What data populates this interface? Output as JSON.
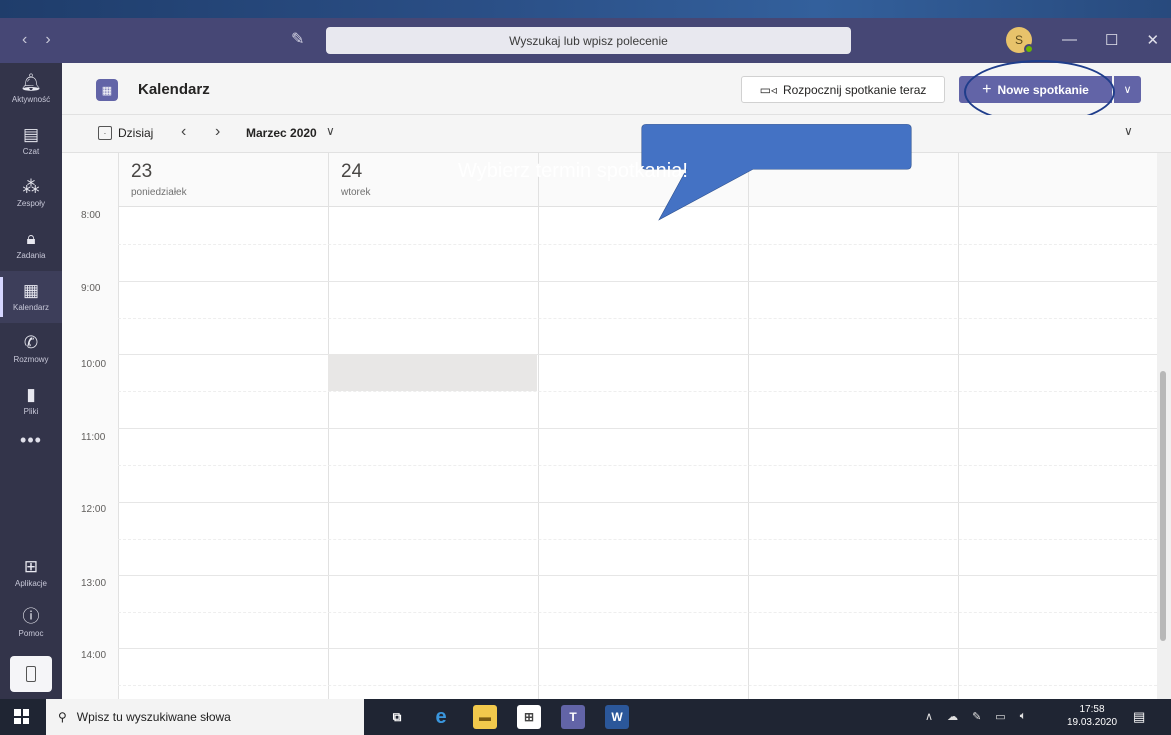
{
  "titlebar": {
    "back": "‹",
    "forward": "›",
    "search_placeholder": "Wyszukaj lub wpisz polecenie",
    "avatar_initial": "S",
    "minimize": "—",
    "maximize": "☐",
    "close": "✕"
  },
  "rail": {
    "items": [
      {
        "label": "Aktywność",
        "icon": "bell-icon"
      },
      {
        "label": "Czat",
        "icon": "chat-icon"
      },
      {
        "label": "Zespoły",
        "icon": "teams-icon"
      },
      {
        "label": "Zadania",
        "icon": "tasks-icon"
      },
      {
        "label": "Kalendarz",
        "icon": "calendar-icon"
      },
      {
        "label": "Rozmowy",
        "icon": "phone-icon"
      },
      {
        "label": "Pliki",
        "icon": "file-icon"
      },
      {
        "label": "Aplikacje",
        "icon": "apps-icon"
      },
      {
        "label": "Pomoc",
        "icon": "help-icon"
      }
    ],
    "more": "•••",
    "active": "Kalendarz"
  },
  "header": {
    "title": "Kalendarz",
    "meet_now": "Rozpocznij spotkanie teraz",
    "new_meeting": "Nowe spotkanie"
  },
  "toolbar": {
    "today": "Dzisiaj",
    "month": "Marzec 2020"
  },
  "calendar": {
    "days": [
      {
        "num": "23",
        "name": "poniedziałek"
      },
      {
        "num": "24",
        "name": "wtorek"
      }
    ],
    "times": [
      "8:00",
      "9:00",
      "10:00",
      "11:00",
      "12:00",
      "13:00",
      "14:00"
    ]
  },
  "callout": {
    "text": "Wybierz termin spotkania!",
    "fill": "#4472c4",
    "stroke": "#2f528f"
  },
  "taskbar": {
    "search_placeholder": "Wpisz tu wyszukiwane słowa",
    "time": "17:58",
    "date": "19.03.2020"
  },
  "colors": {
    "titlebar": "#464775",
    "rail": "#33344a",
    "accent": "#6264a7"
  }
}
